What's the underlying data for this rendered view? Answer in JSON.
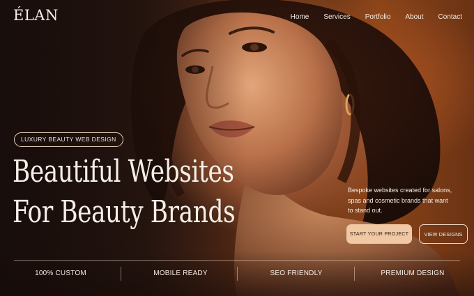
{
  "brand": {
    "logo": "ÉLAN"
  },
  "nav": {
    "items": [
      "Home",
      "Services",
      "Portfolio",
      "About",
      "Contact"
    ]
  },
  "hero": {
    "badge": "LUXURY BEAUTY WEB DESIGN",
    "headline_line1": "Beautiful Websites",
    "headline_line2": "For Beauty Brands",
    "tagline": "Bespoke websites created for salons, spas and cosmetic brands that want to stand out.",
    "primary_cta": "START YOUR PROJECT",
    "secondary_cta": "VIEW DESIGNS"
  },
  "features": [
    "100% CUSTOM",
    "MOBILE READY",
    "SEO FRIENDLY",
    "PREMIUM DESIGN"
  ],
  "colors": {
    "accent": "#f0c9a4",
    "background_dark": "#1e1210",
    "background_warm": "#8a4418"
  }
}
